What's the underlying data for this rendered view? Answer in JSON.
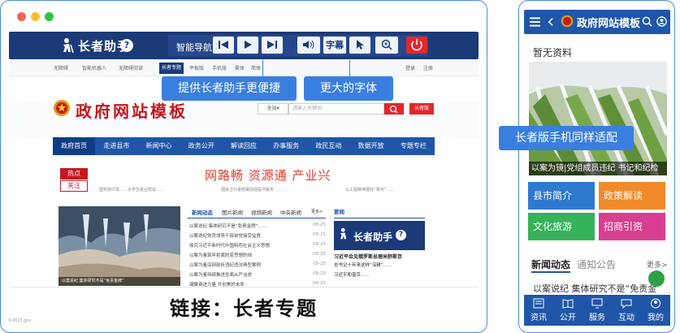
{
  "desktop": {
    "helper_title": "长者助手",
    "help_mark": "?",
    "smart_nav_label": "智能导航",
    "caption_button": "字幕",
    "subbar_items": [
      "无障碍",
      "智能机器人",
      "无障碍阅读",
      "长者专题",
      "平板版",
      "手机版",
      "繁体",
      "简体"
    ],
    "subbar_right": [
      "登录",
      "注册"
    ],
    "callouts": {
      "helper": "提供长者助手更便捷",
      "font": "更大的字体"
    },
    "site_title": "政府网站模板",
    "search_select": "全站▾",
    "search_placeholder": "请输入关键词",
    "special_topic": "长者版",
    "nav": [
      "政府首页",
      "走进县市",
      "新闻中心",
      "政务公开",
      "解读回应",
      "办事服务",
      "政民互动",
      "数据开放",
      "专题专栏"
    ],
    "hot_tag": "热点",
    "focus_tag": "关注",
    "slogan": "网路畅 资源通 产业兴",
    "hot_lines": [
      "国务院印发……大学生就业帮扶……",
      "国家卫计委部署加强医疗服务……",
      "以工程精神建好“淮河”……"
    ],
    "photo_caption": "以案说纪 集体研究不是“免责金牌”",
    "tabs": [
      "新闻动态",
      "图片新闻",
      "视频新闻",
      "中央新闻",
      "更多>"
    ],
    "news": [
      {
        "title": "以案说纪 集体研究不是“免责金牌”……",
        "date": "08-25"
      },
      {
        "title": "以案说纪党员领导干部自觉接受监督",
        "date": "08-25"
      },
      {
        "title": "探究习近平新时代中国特色社会主义思想",
        "date": "08-25"
      },
      {
        "title": "以案为鉴筑牢拒腐防变思想防线",
        "date": "08-25"
      },
      {
        "title": "以案为鉴深刻剖析违纪违法典型案例",
        "date": "08-25"
      },
      {
        "title": "以案为鉴持续推进全面从严治党",
        "date": "08-25"
      },
      {
        "title": "凝聚奋进力量 共创美好未来",
        "date": "08-25"
      },
      {
        "title": "以案说纪党员干部要知敬畏守底线",
        "date": "08-25"
      }
    ],
    "right_head": "要闻",
    "right_lines": [
      "习近平会见俄罗斯总理米舒斯京",
      "总书记十年来这样“深耕”……",
      "习近平和普京……"
    ],
    "bottom_link": "链接：长者专题",
    "tiny_footer": "©2023 gov"
  },
  "mobile": {
    "title": "政府网站模板",
    "empty_text": "暂无资料",
    "photo_caption": "以案为镜|党组成员违纪 书记和纪检",
    "callout": "长者版手机同样适配",
    "tiles": [
      {
        "label": "县市简介",
        "color": "#2f78d0"
      },
      {
        "label": "政策解读",
        "color": "#f08a2a"
      },
      {
        "label": "文化旅游",
        "color": "#35b25a"
      },
      {
        "label": "招商引资",
        "color": "#d83e92"
      }
    ],
    "news_tab": "新闻动态",
    "notice_tab": "通知公告",
    "more": "更多>",
    "news_line": "以案说纪 集体研究不是“免责金",
    "bottom_tabs": [
      "资讯",
      "公开",
      "服务",
      "互动",
      "我的"
    ]
  },
  "colors": {
    "accent": "#3a7fe0",
    "toolbar": "#1b3a78",
    "nav": "#1f56a8",
    "red": "#e3262a"
  }
}
